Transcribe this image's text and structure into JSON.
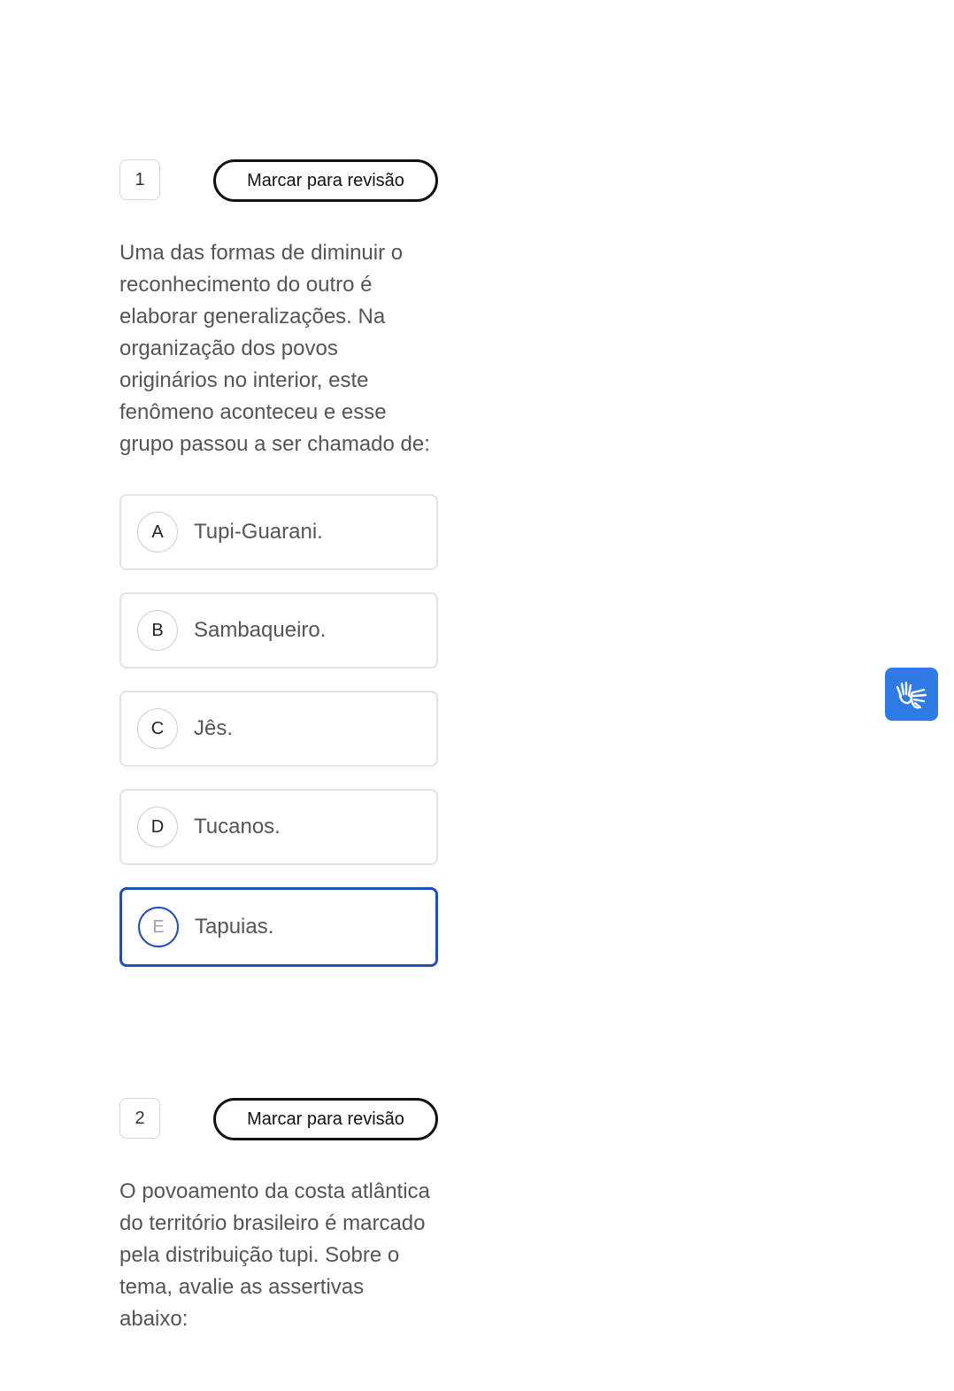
{
  "questions": [
    {
      "number": "1",
      "review_label": "Marcar para revisão",
      "text": "Uma das formas de diminuir o reconhecimento do outro é elaborar generalizações. Na organização dos povos originários no interior, este fenômeno aconteceu e esse grupo passou a ser chamado de:",
      "options": [
        {
          "letter": "A",
          "text": "Tupi-Guarani."
        },
        {
          "letter": "B",
          "text": "Sambaqueiro."
        },
        {
          "letter": "C",
          "text": "Jês."
        },
        {
          "letter": "D",
          "text": "Tucanos."
        },
        {
          "letter": "E",
          "text": "Tapuias."
        }
      ],
      "selected": "E"
    },
    {
      "number": "2",
      "review_label": "Marcar para revisão",
      "text": "O povoamento da costa atlântica do território brasileiro é marcado pela distribuição tupi. Sobre o tema, avalie as assertivas abaixo:"
    }
  ],
  "accessibility_button": {
    "icon": "sign-language-hands-icon",
    "color": "#2f7be5"
  },
  "colors": {
    "selected_border": "#1f4fb8",
    "accent": "#2f7be5"
  }
}
